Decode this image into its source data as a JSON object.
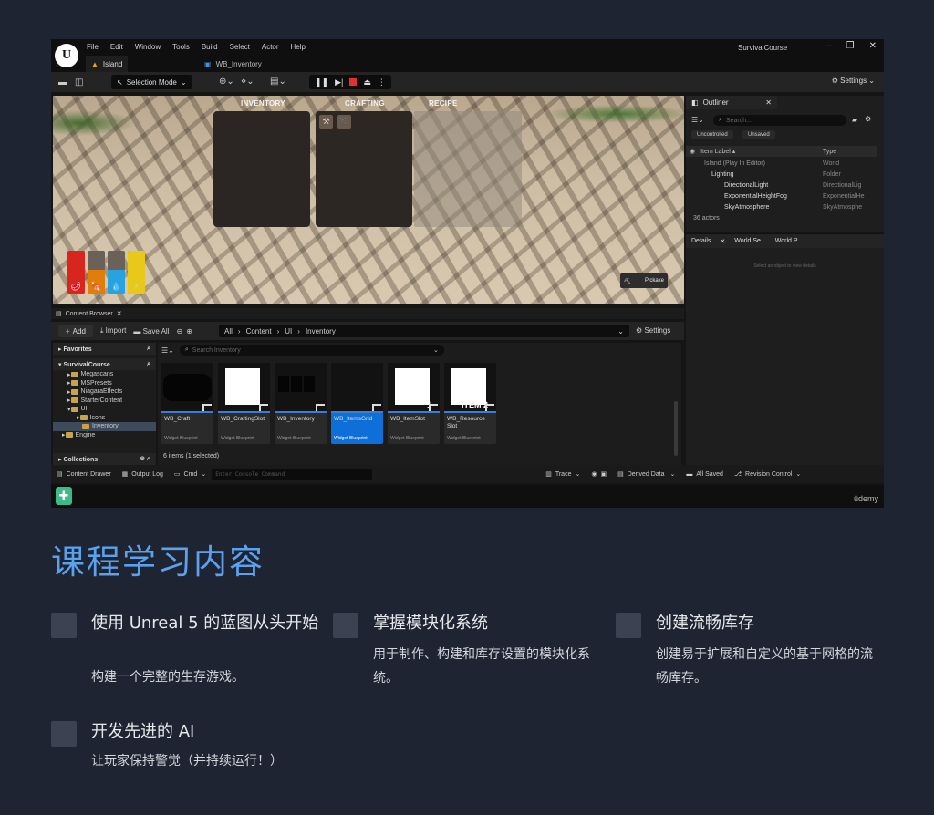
{
  "editor": {
    "menus": [
      "File",
      "Edit",
      "Window",
      "Tools",
      "Build",
      "Select",
      "Actor",
      "Help"
    ],
    "project": "SurvivalCourse",
    "tabs": [
      {
        "label": "Island"
      },
      {
        "label": "WB_Inventory"
      }
    ],
    "toolbar": {
      "selection_mode": "Selection Mode",
      "settings": "Settings"
    },
    "viewport": {
      "headers": {
        "inventory": "INVENTORY",
        "crafting": "CRAFTING",
        "recipe": "RECIPE"
      },
      "stats": [
        {
          "color": "#d8261e",
          "fill": 1.0,
          "icon": "meat-icon"
        },
        {
          "color": "#e07d0c",
          "fill": 0.55,
          "icon": "food-icon"
        },
        {
          "color": "#2aa2e0",
          "fill": 0.55,
          "icon": "water-drop-icon"
        },
        {
          "color": "#e8c819",
          "fill": 1.0,
          "icon": "energy-icon"
        }
      ],
      "equipped": "Pickaxe"
    },
    "outliner": {
      "title": "Outliner",
      "search_placeholder": "Search...",
      "filters": [
        "Uncontrolled",
        "Unsaved"
      ],
      "col_label": "Item Label ▴",
      "col_type": "Type",
      "rows": [
        {
          "label": "Island (Play In Editor)",
          "type": "World"
        },
        {
          "label": "Lighting",
          "type": "Folder"
        },
        {
          "label": "DirectionalLight",
          "type": "DirectionalLig"
        },
        {
          "label": "ExponentialHeightFog",
          "type": "ExponentialHe"
        },
        {
          "label": "SkyAtmosphere",
          "type": "SkyAtmosphe"
        }
      ],
      "actor_count": "36 actors"
    },
    "details": {
      "tabs": [
        "Details",
        "World Se...",
        "World P..."
      ],
      "empty_message": "Select an object to view details"
    },
    "content_browser": {
      "title": "Content Browser",
      "add": "Add",
      "import": "Import",
      "save_all": "Save All",
      "breadcrumb": [
        "All",
        "Content",
        "UI",
        "Inventory"
      ],
      "settings": "Settings",
      "favorites": "Favorites",
      "root": "SurvivalCourse",
      "folders": [
        "Megascans",
        "MSPresets",
        "NiagaraEffects",
        "StarterContent",
        "UI",
        "Icons",
        "Inventory",
        "Engine"
      ],
      "collections": "Collections",
      "search_placeholder": "Search Inventory",
      "assets": [
        {
          "name": "WB_Craft",
          "type": "Widget Blueprint",
          "thumb_text": ""
        },
        {
          "name": "WB_CraftingSlot",
          "type": "Widget Blueprint",
          "thumb_text": ""
        },
        {
          "name": "WB_Inventory",
          "type": "Widget Blueprint",
          "thumb_text": ""
        },
        {
          "name": "WB_ItemsGrid",
          "type": "Widget Blueprint",
          "thumb_text": ""
        },
        {
          "name": "WB_ItemSlot",
          "type": "Widget Blueprint",
          "thumb_text": "1"
        },
        {
          "name": "WB_Resource Slot",
          "type": "Widget Blueprint",
          "thumb_text": "ITEM 2"
        }
      ],
      "item_count": "6 items (1 selected)"
    },
    "statusbar": {
      "content_drawer": "Content Drawer",
      "output_log": "Output Log",
      "cmd": "Cmd",
      "console_placeholder": "Enter Console Command",
      "trace": "Trace",
      "derived_data": "Derived Data",
      "all_saved": "All Saved",
      "revision_control": "Revision Control"
    },
    "brand": "ûdemy"
  },
  "course": {
    "heading": "课程学习内容",
    "features": [
      {
        "title": "使用 Unreal 5 的蓝图从头开始",
        "desc": "构建一个完整的生存游戏。"
      },
      {
        "title": "掌握模块化系统",
        "desc": "用于制作、构建和库存设置的模块化系统。"
      },
      {
        "title": "创建流畅库存",
        "desc": "创建易于扩展和自定义的基于网格的流畅库存。"
      },
      {
        "title": "开发先进的 AI",
        "desc": "让玩家保持警觉（并持续运行！）"
      }
    ]
  }
}
